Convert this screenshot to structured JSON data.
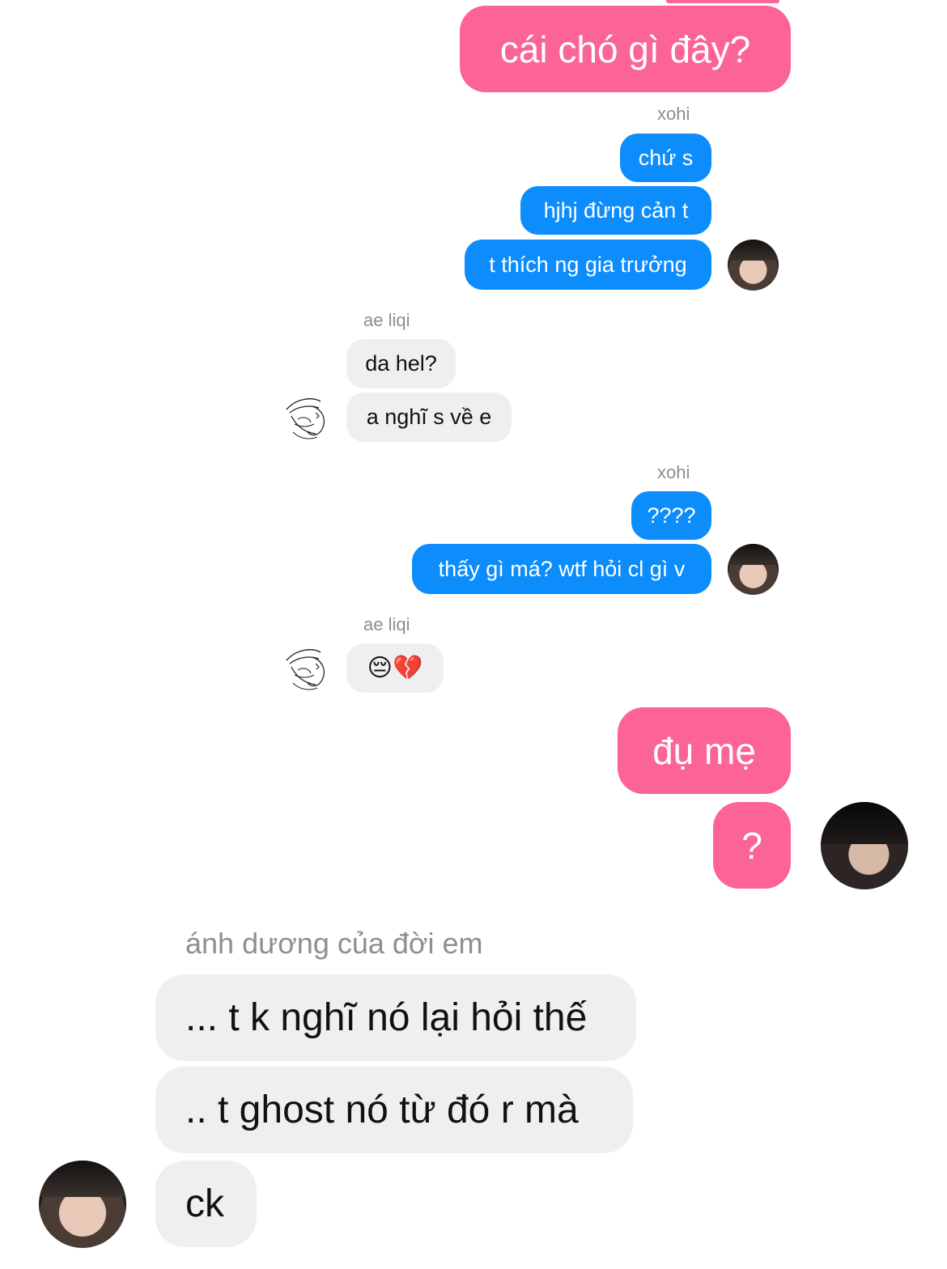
{
  "colors": {
    "pink_bubble": "#fb6399",
    "blue_bubble": "#0d8cfb",
    "gray_bubble": "#efeff1",
    "label_gray": "#8e8e93"
  },
  "messages": {
    "m1": "cái chó gì đây?",
    "label_xohi_1": "xohi",
    "m2": "chứ s",
    "m3": "hjhj đừng cản t",
    "m4": "t thích ng gia trưởng",
    "label_aeliqi_1": "ae liqi",
    "m5": "da hel?",
    "m6": "a nghĩ s về e",
    "label_xohi_2": "xohi",
    "m7": "????",
    "m8": "thấy gì má? wtf hỏi cl gì v",
    "label_aeliqi_2": "ae liqi",
    "m9": "😔💔",
    "m10": "đụ mẹ",
    "m11": "?",
    "label_anhduong": "ánh dương của đời em",
    "m12": "... t k nghĩ nó lại hỏi thế",
    "m13": ".. t ghost nó từ đó r mà",
    "m14": "ck"
  },
  "icons": {
    "avatar_xohi": "avatar-photo",
    "avatar_aeliqi": "avatar-sketch",
    "avatar_me": "avatar-photo",
    "avatar_anhduong": "avatar-photo"
  }
}
